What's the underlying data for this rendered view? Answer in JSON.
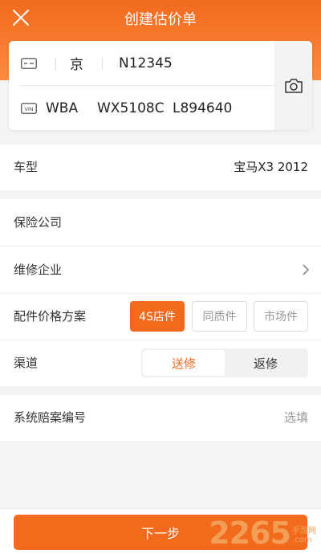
{
  "header": {
    "title": "创建估价单"
  },
  "plate": {
    "province": "京",
    "number": "N12345",
    "vin_part1": "WBA",
    "vin_part2": "WX5108C",
    "vin_part3": "L894640"
  },
  "vehicle": {
    "label": "车型",
    "value": "宝马X3 2012"
  },
  "form": {
    "insurer_label": "保险公司",
    "repair_label": "维修企业",
    "parts_label": "配件价格方案",
    "parts_options": [
      "4S店件",
      "同质件",
      "市场件"
    ],
    "parts_selected": "4S店件",
    "channel_label": "渠道",
    "channel_options": [
      "送修",
      "返修"
    ],
    "channel_selected": "送修"
  },
  "claim": {
    "label": "系统赔案编号",
    "hint": "选填"
  },
  "footer": {
    "next_label": "下一步"
  },
  "watermark": {
    "text": "2265",
    "suffix_line1": "手游网",
    "suffix_line2": ".com"
  },
  "colors": {
    "accent": "#f26b1d",
    "background": "#f4f4f4"
  }
}
